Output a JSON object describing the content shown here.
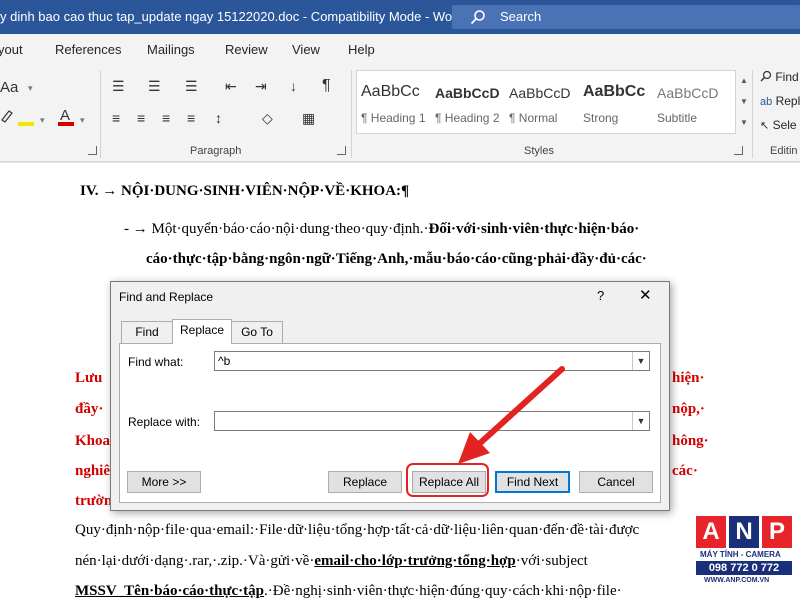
{
  "window": {
    "title": "y dinh bao cao thuc tap_update ngay 15122020.doc  -  Compatibility Mode  -  Word",
    "search_label": "Search"
  },
  "menu": {
    "tabs": [
      "yout",
      "References",
      "Mailings",
      "Review",
      "View",
      "Help"
    ]
  },
  "ribbon": {
    "groups": {
      "paragraph": "Paragraph",
      "styles": "Styles",
      "editing": "Editin"
    },
    "styles": [
      {
        "preview": "AaBbCc",
        "name": "¶ Heading 1"
      },
      {
        "preview": "AaBbCcD",
        "name": "¶ Heading 2"
      },
      {
        "preview": "AaBbCcD",
        "name": "¶ Normal"
      },
      {
        "preview": "AaBbCc",
        "name": "Strong"
      },
      {
        "preview": "AaBbCcD",
        "name": "Subtitle"
      }
    ],
    "editing": {
      "find": "Find",
      "replace": "Repl",
      "select": "Sele"
    }
  },
  "document": {
    "heading": "IV. → NỘI·DUNG·SINH·VIÊN·NỘP·VỀ·KHOA:¶",
    "bullet_line1_normal": "- → Một·quyển·báo·cáo·nội·dung·theo·quy·định.·",
    "bullet_line1_bold": "Đối·với·sinh·viên·thực·hiện·báo·",
    "bullet_line2": "cáo·thực·tập·bằng·ngôn·ngữ·Tiếng·Anh,·mẫu·báo·cáo·cũng·phải·đầy·đủ·các·",
    "red_left": [
      "Lưu",
      "đầy·",
      "Khoa",
      "nghiê",
      "trườn"
    ],
    "red_right": [
      "hiện·",
      "nộp,·",
      "hông·",
      "các·"
    ],
    "line_email1": "Quy·định·nộp·file·qua·email:·File·dữ·liệu·tổng·hợp·tất·cả·dữ·liệu·liên·quan·đến·đề·tài·được",
    "line_email2_a": "nén·lại·dưới·dạng·.rar,·.zip.·Và·gửi·về·",
    "line_email2_b": "email·cho·lớp·trưởng·tổng·hợp",
    "line_email2_c": "·với·subject",
    "line_email3_a": "MSSV_Tên·báo·cáo·thực·tập",
    "line_email3_b": ".·Đề·nghị·sinh·viên·thực·hiện·đúng·quy·cách·khi·nộp·file·"
  },
  "dialog": {
    "title": "Find and Replace",
    "help": "?",
    "close": "✕",
    "tabs": [
      "Find",
      "Replace",
      "Go To"
    ],
    "active_tab": "Replace",
    "find_label": "Find what:",
    "find_value": "^b",
    "replace_label": "Replace with:",
    "replace_value": "",
    "buttons": {
      "more": "More >>",
      "replace": "Replace",
      "replace_all": "Replace All",
      "find_next": "Find Next",
      "cancel": "Cancel"
    }
  },
  "watermark": {
    "letters": [
      "A",
      "N",
      "P"
    ],
    "tagline": "MÁY TÍNH - CAMERA",
    "phone": "098 772 0 772",
    "url": "WWW.ANP.COM.VN"
  },
  "colors": {
    "titlebar": "#2b579a",
    "annotation": "#e32222",
    "default_button": "#0078d7",
    "red_text": "#d40000"
  }
}
